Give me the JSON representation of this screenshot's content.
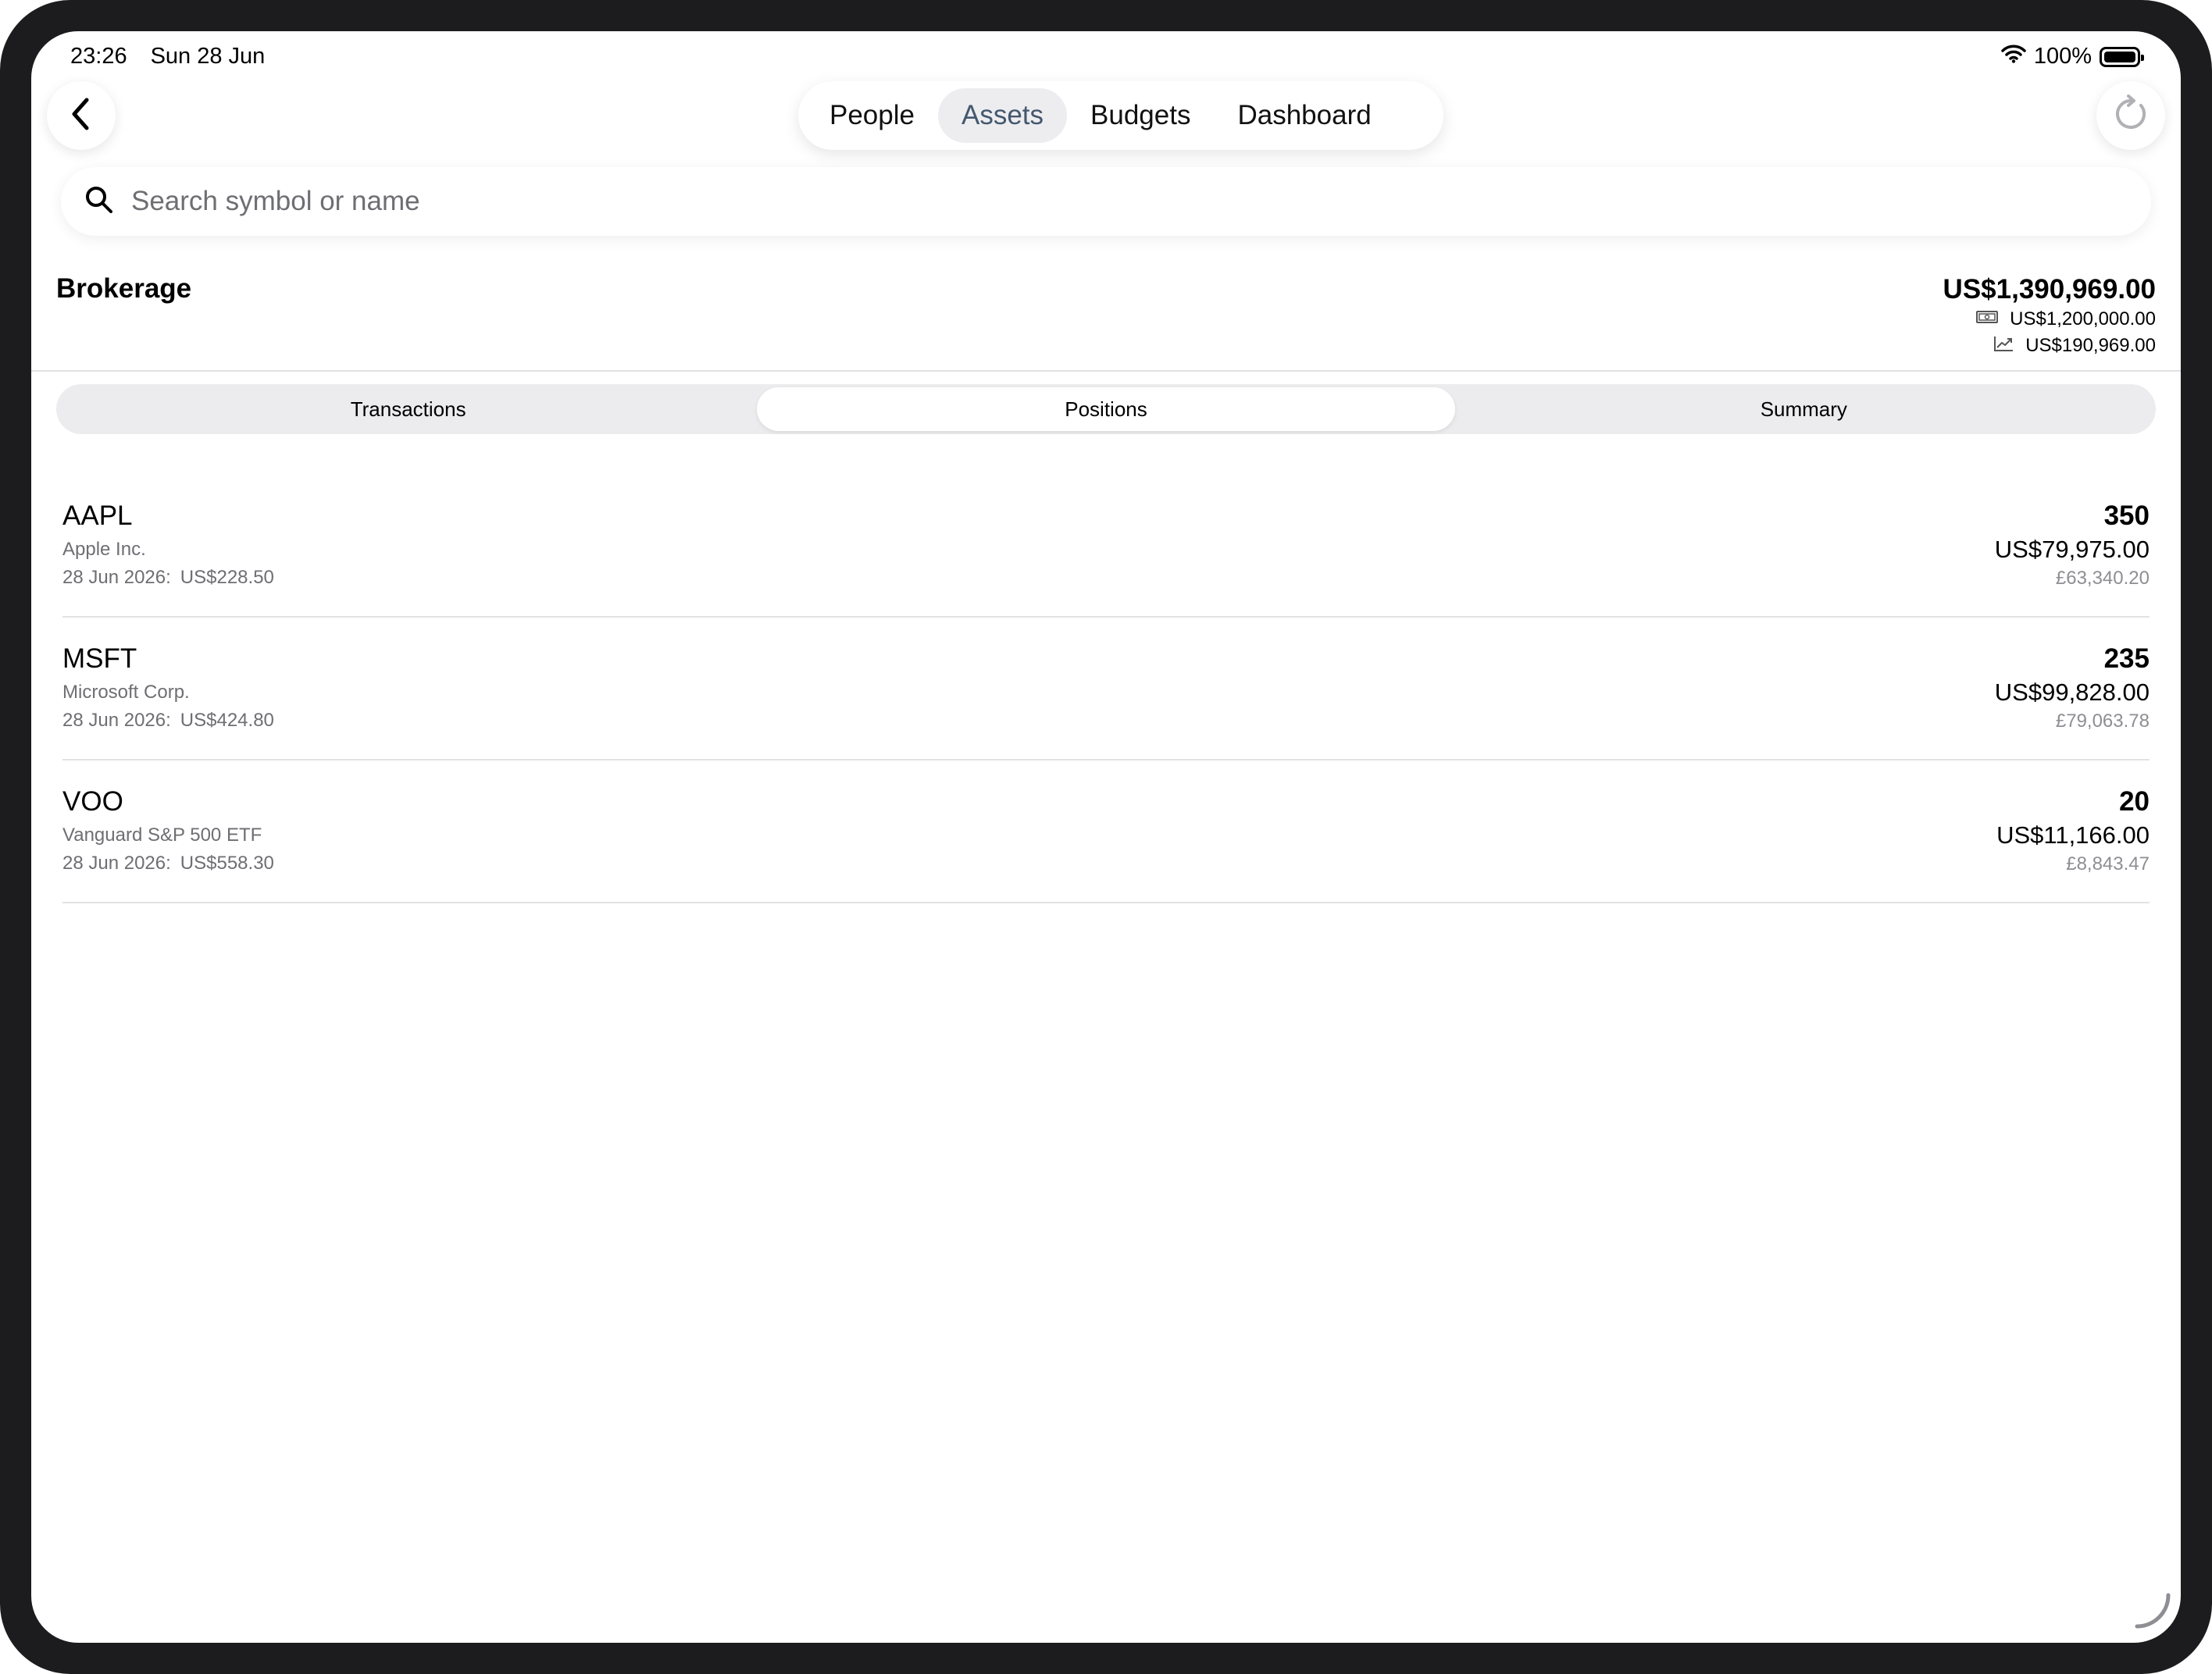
{
  "status_bar": {
    "time": "23:26",
    "date": "Sun 28 Jun",
    "battery": "100%",
    "battery_level": 1.0
  },
  "nav": {
    "tabs": [
      {
        "label": "People",
        "active": false
      },
      {
        "label": "Assets",
        "active": true
      },
      {
        "label": "Budgets",
        "active": false
      },
      {
        "label": "Dashboard",
        "active": false
      }
    ]
  },
  "search": {
    "placeholder": "Search symbol or name",
    "value": ""
  },
  "account": {
    "name": "Brokerage",
    "total": "US$1,390,969.00",
    "cost_basis": "US$1,200,000.00",
    "gain": "US$190,969.00"
  },
  "segments": {
    "items": [
      {
        "label": "Transactions",
        "active": false
      },
      {
        "label": "Positions",
        "active": true
      },
      {
        "label": "Summary",
        "active": false
      }
    ]
  },
  "positions": [
    {
      "symbol": "AAPL",
      "name": "Apple Inc.",
      "date": "28 Jun 2026:",
      "price": "US$228.50",
      "quantity": "350",
      "value_usd": "US$79,975.00",
      "value_gbp": "£63,340.20"
    },
    {
      "symbol": "MSFT",
      "name": "Microsoft Corp.",
      "date": "28 Jun 2026:",
      "price": "US$424.80",
      "quantity": "235",
      "value_usd": "US$99,828.00",
      "value_gbp": "£79,063.78"
    },
    {
      "symbol": "VOO",
      "name": "Vanguard S&P 500 ETF",
      "date": "28 Jun 2026:",
      "price": "US$558.30",
      "quantity": "20",
      "value_usd": "US$11,166.00",
      "value_gbp": "£8,843.47"
    }
  ],
  "colors": {
    "active_tab_text": "#44586e",
    "active_tab_bg": "#ededf0",
    "secondary_text": "#6e6e73",
    "device_frame": "#1c1c1e"
  }
}
